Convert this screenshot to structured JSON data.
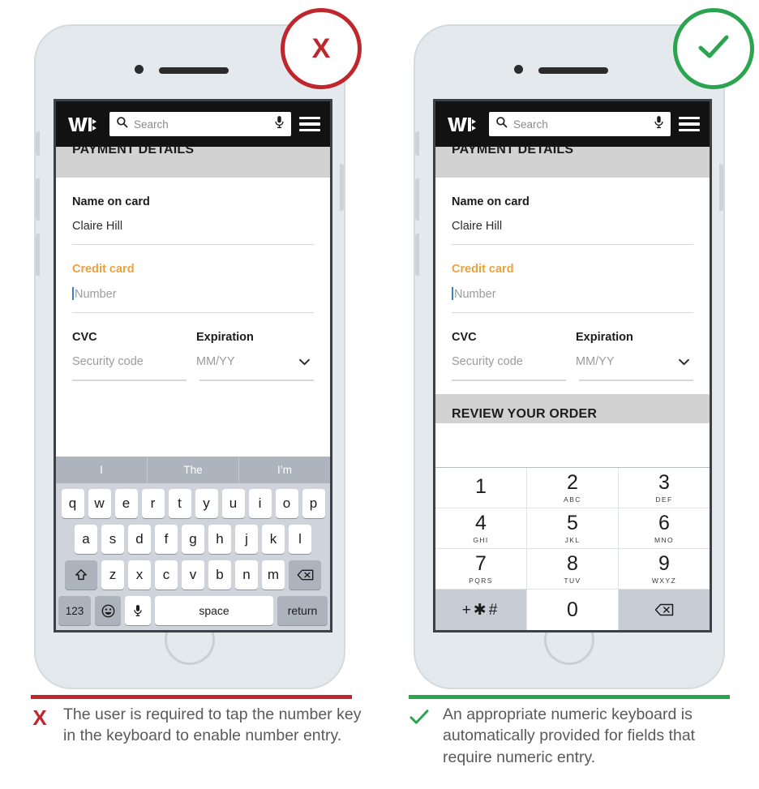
{
  "panels": [
    {
      "id": "bad-example",
      "badge": {
        "icon": "x-icon",
        "mark": "X",
        "color": "#c0272d"
      },
      "header": {
        "logo": "walmart-logo-icon",
        "search_placeholder": "Search",
        "search_icon": "search-icon",
        "mic_icon": "microphone-icon",
        "menu_icon": "hamburger-menu-icon"
      },
      "section_title": "PAYMENT DETAILS",
      "form": {
        "name_label": "Name on card",
        "name_value": "Claire Hill",
        "card_label": "Credit card",
        "card_placeholder": "Number",
        "cvc_label": "CVC",
        "cvc_placeholder": "Security  code",
        "exp_label": "Expiration",
        "exp_placeholder": "MM/YY",
        "exp_chevron": "chevron-down-icon"
      },
      "keyboard": {
        "type": "qwerty",
        "suggestions": [
          "I",
          "The",
          "I’m"
        ],
        "row1": [
          "q",
          "w",
          "e",
          "r",
          "t",
          "y",
          "u",
          "i",
          "o",
          "p"
        ],
        "row2": [
          "a",
          "s",
          "d",
          "f",
          "g",
          "h",
          "j",
          "k",
          "l"
        ],
        "row3": [
          "z",
          "x",
          "c",
          "v",
          "b",
          "n",
          "m"
        ],
        "shift_icon": "shift-arrow-icon",
        "delete_icon": "backspace-icon",
        "num_key": "123",
        "emoji_icon": "emoji-smiley-icon",
        "mic_icon": "microphone-icon",
        "space_key": "space",
        "return_key": "return"
      },
      "rule_color": "#c0272d",
      "caption_mark": "X",
      "caption_text": "The user is required to tap the number key in the keyboard to enable number entry."
    },
    {
      "id": "good-example",
      "badge": {
        "icon": "check-icon",
        "mark": "✓",
        "color": "#2aa44f"
      },
      "header": {
        "logo": "walmart-logo-icon",
        "search_placeholder": "Search",
        "search_icon": "search-icon",
        "mic_icon": "microphone-icon",
        "menu_icon": "hamburger-menu-icon"
      },
      "section_title": "PAYMENT DETAILS",
      "review_title": "REVIEW YOUR ORDER",
      "form": {
        "name_label": "Name on card",
        "name_value": "Claire Hill",
        "card_label": "Credit card",
        "card_placeholder": "Number",
        "cvc_label": "CVC",
        "cvc_placeholder": "Security  code",
        "exp_label": "Expiration",
        "exp_placeholder": "MM/YY",
        "exp_chevron": "chevron-down-icon"
      },
      "keyboard": {
        "type": "numeric",
        "keys": [
          [
            {
              "digit": "1",
              "letters": ""
            },
            {
              "digit": "2",
              "letters": "ABC"
            },
            {
              "digit": "3",
              "letters": "DEF"
            }
          ],
          [
            {
              "digit": "4",
              "letters": "GHI"
            },
            {
              "digit": "5",
              "letters": "JKL"
            },
            {
              "digit": "6",
              "letters": "MNO"
            }
          ],
          [
            {
              "digit": "7",
              "letters": "PQRS"
            },
            {
              "digit": "8",
              "letters": "TUV"
            },
            {
              "digit": "9",
              "letters": "WXYZ"
            }
          ]
        ],
        "symbol_key": "+✱#",
        "zero_key": "0",
        "delete_icon": "backspace-icon"
      },
      "rule_color": "#2aa44f",
      "caption_mark": "✓",
      "caption_text": "An appropriate numeric keyboard is automatically provided for fields that require numeric entry."
    }
  ],
  "colors": {
    "accent_orange": "#eda13a",
    "bad_red": "#c0272d",
    "good_green": "#2aa44f",
    "header_black": "#121212",
    "band_grey": "#d2d2d2"
  }
}
